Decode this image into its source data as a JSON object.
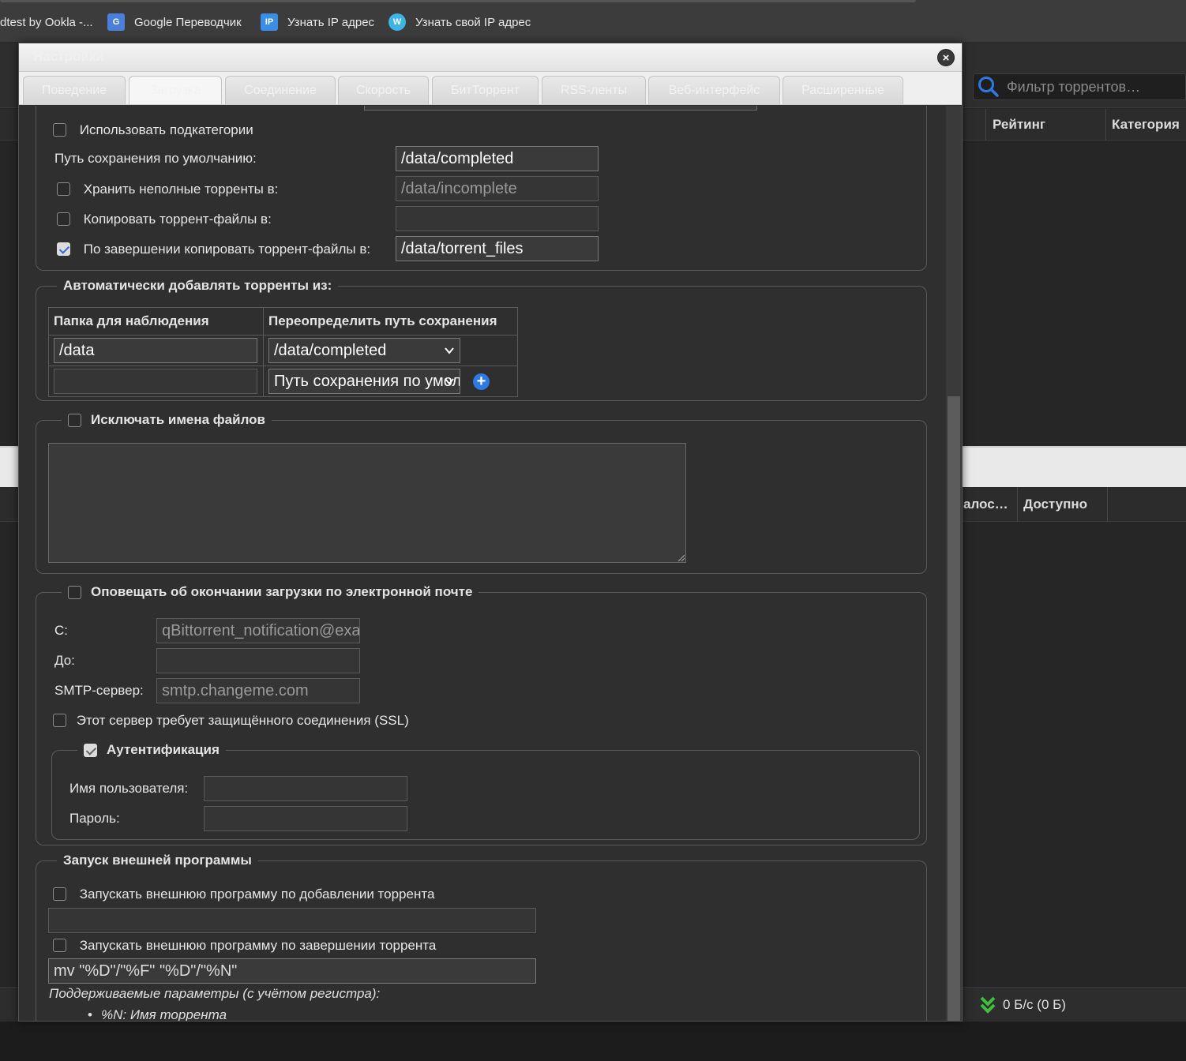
{
  "bookmarks": [
    {
      "label": "dtest by Ookla -...",
      "icon": "ookla-icon"
    },
    {
      "label": "Google Переводчик",
      "icon": "google-translate-icon"
    },
    {
      "label": "Узнать IP адрес",
      "icon": "ip-icon"
    },
    {
      "label": "Узнать свой IP адрес",
      "icon": "w-icon"
    }
  ],
  "background": {
    "filter_placeholder": "Фильтр торрентов…",
    "col_rating": "Рейтинг",
    "col_category": "Категория",
    "col_remaining": "алос…",
    "col_available": "Доступно",
    "speed": "0 Б/с (0 Б)"
  },
  "modal": {
    "title": "Настройки",
    "close_label": "×",
    "tabs": [
      "Поведение",
      "Загрузка",
      "Соединение",
      "Скорость",
      "БитТоррент",
      "RSS-ленты",
      "Веб-интерфейс",
      "Расширенные"
    ],
    "active_tab": "Загрузка"
  },
  "saving": {
    "use_subcategories": {
      "label": "Использовать подкатегории",
      "checked": false
    },
    "default_path_label": "Путь сохранения по умолчанию:",
    "default_path_value": "/data/completed",
    "incomplete": {
      "label": "Хранить неполные торренты в:",
      "checked": false,
      "value": "/data/incomplete"
    },
    "copy_torrent": {
      "label": "Копировать торрент-файлы в:",
      "checked": false,
      "value": ""
    },
    "copy_finished": {
      "label": "По завершении копировать торрент-файлы в:",
      "checked": true,
      "value": "/data/torrent_files"
    }
  },
  "watched": {
    "legend": "Автоматически добавлять торренты из:",
    "col_folder": "Папка для наблюдения",
    "col_override": "Переопределить путь сохранения",
    "rows": [
      {
        "folder": "/data",
        "override": "/data/completed"
      },
      {
        "folder": "",
        "override": "Путь сохранения по умолчанию"
      }
    ]
  },
  "exclude": {
    "legend": "Исключать имена файлов",
    "checked": false,
    "text": ""
  },
  "email": {
    "legend": "Оповещать об окончании загрузки по электронной почте",
    "checked": false,
    "from_label": "С:",
    "from_value": "qBittorrent_notification@example.com",
    "to_label": "До:",
    "to_value": "",
    "smtp_label": "SMTP-сервер:",
    "smtp_value": "smtp.changeme.com",
    "ssl_label": "Этот сервер требует защищённого соединения (SSL)",
    "ssl_checked": false,
    "auth": {
      "legend": "Аутентификация",
      "checked": true,
      "username_label": "Имя пользователя:",
      "username_value": "",
      "password_label": "Пароль:",
      "password_value": ""
    }
  },
  "external": {
    "legend": "Запуск внешней программы",
    "on_add": {
      "label": "Запускать внешнюю программу по добавлении торрента",
      "checked": false,
      "value": ""
    },
    "on_finish": {
      "label": "Запускать внешнюю программу по завершении торрента",
      "checked": false,
      "value": "mv \"%D\"/\"%F\" \"%D\"/\"%N\""
    },
    "hint": "Поддерживаемые параметры (с учётом регистра):",
    "params": [
      "%N: Имя торрента"
    ]
  },
  "colors": {
    "accent": "#2d7ae5",
    "download_green": "#3fbf3f"
  }
}
